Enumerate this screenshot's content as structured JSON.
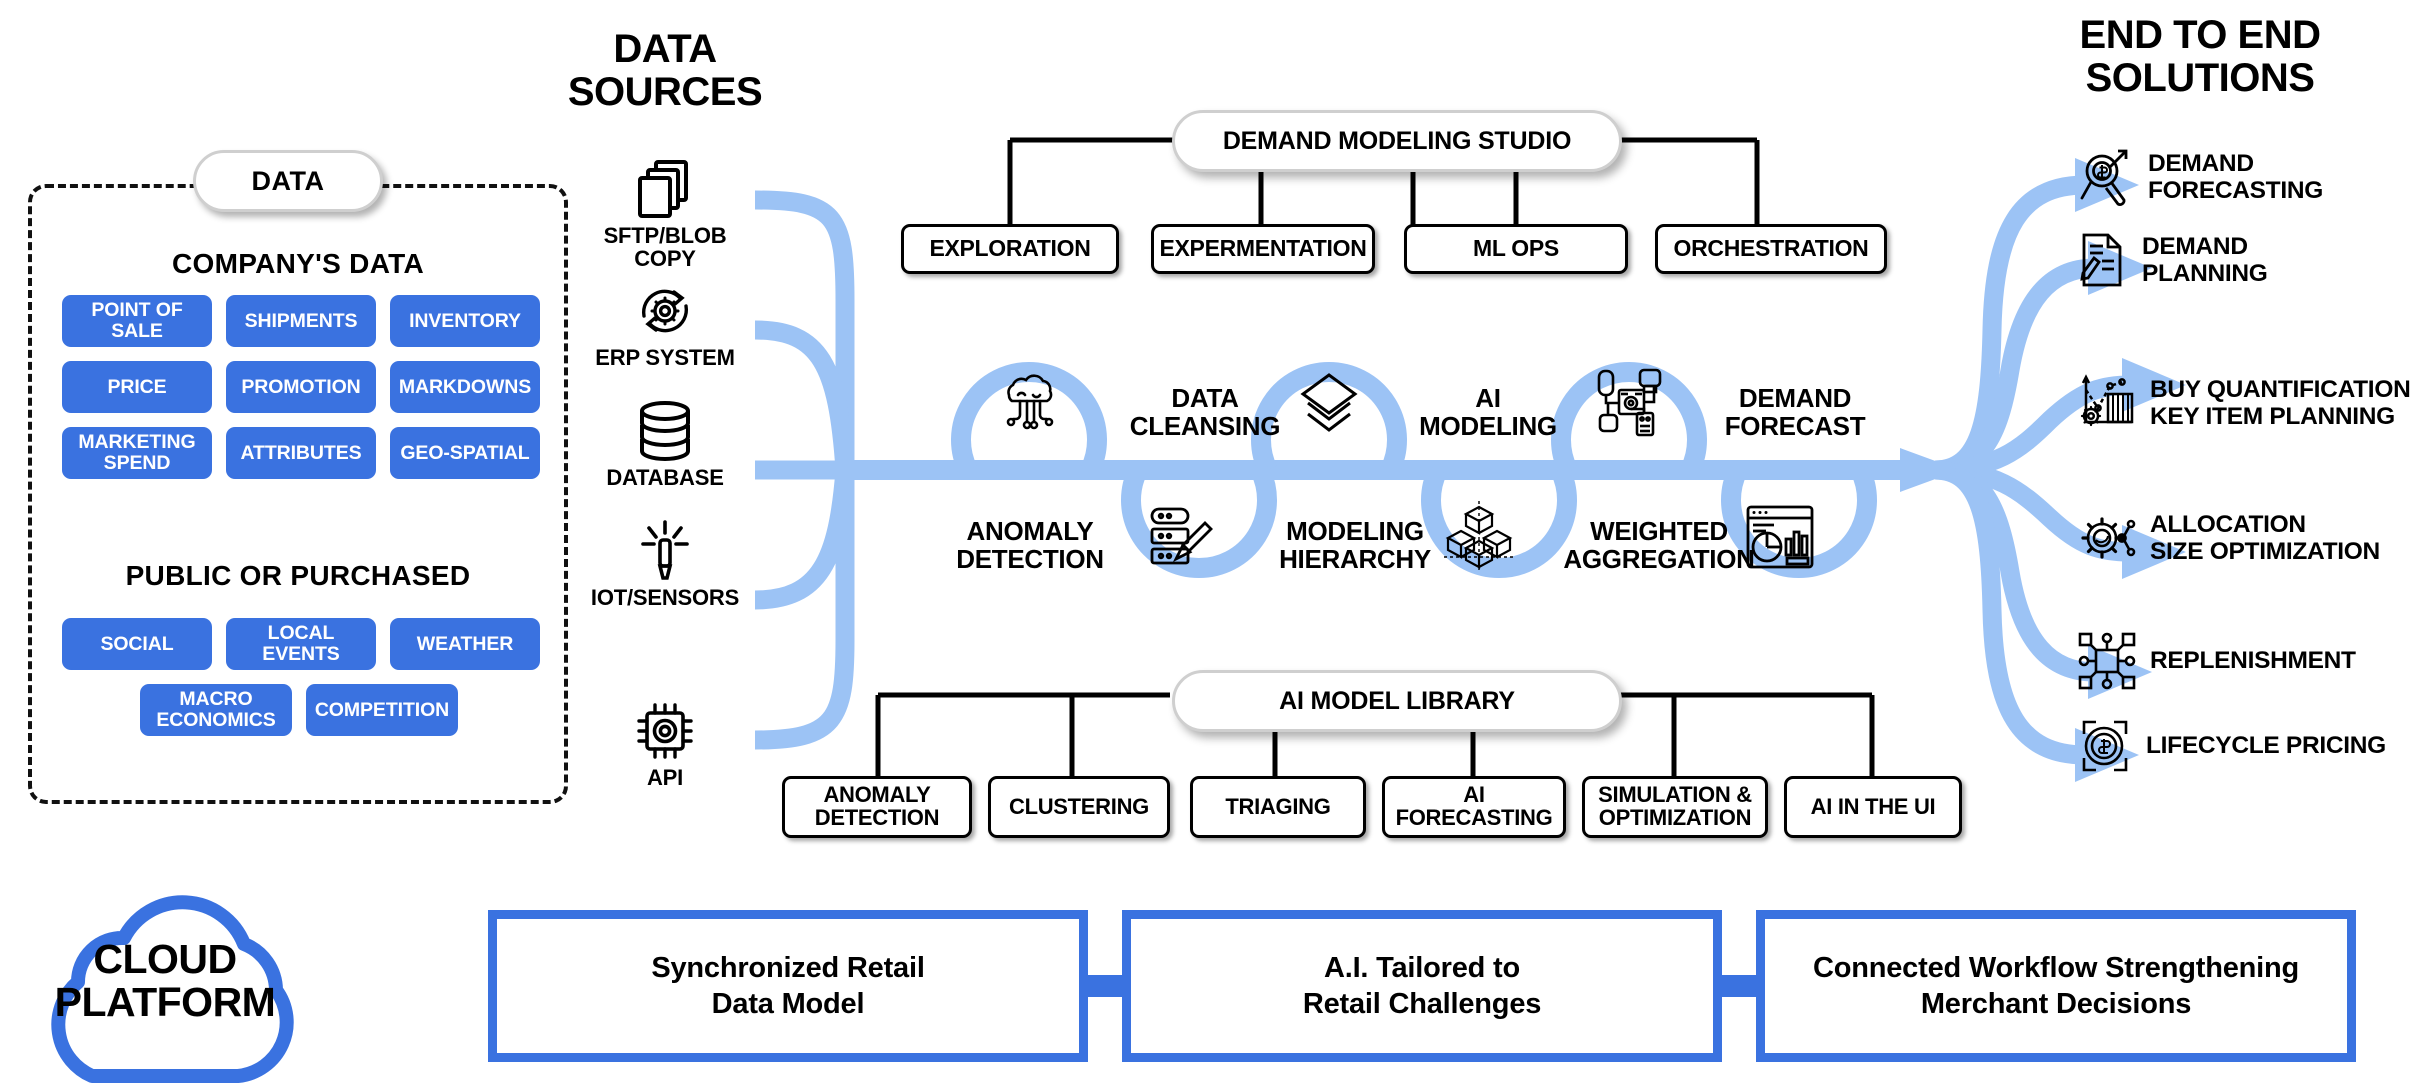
{
  "colors": {
    "brand_blue": "#3a72e0",
    "flow_blue": "#9cc3f5",
    "ink": "#000000"
  },
  "headings": {
    "data_sources": "DATA\nSOURCES",
    "end_to_end": "END TO END\nSOLUTIONS"
  },
  "data_panel": {
    "pill_label": "DATA",
    "company_title": "COMPANY'S DATA",
    "company_chips": [
      "POINT OF\nSALE",
      "SHIPMENTS",
      "INVENTORY",
      "PRICE",
      "PROMOTION",
      "MARKDOWNS",
      "MARKETING\nSPEND",
      "ATTRIBUTES",
      "GEO-SPATIAL"
    ],
    "public_title": "PUBLIC OR PURCHASED",
    "public_chips": [
      "SOCIAL",
      "LOCAL\nEVENTS",
      "WEATHER",
      "MACRO\nECONOMICS",
      "COMPETITION"
    ]
  },
  "data_sources": [
    {
      "icon": "documents-copy-icon",
      "label": "SFTP/BLOB\nCOPY"
    },
    {
      "icon": "erp-gear-cycle-icon",
      "label": "ERP SYSTEM"
    },
    {
      "icon": "database-icon",
      "label": "DATABASE"
    },
    {
      "icon": "iot-sensor-icon",
      "label": "IOT/SENSORS"
    },
    {
      "icon": "api-chip-icon",
      "label": "API"
    }
  ],
  "demand_modeling_studio": {
    "title": "DEMAND MODELING STUDIO",
    "children": [
      "EXPLORATION",
      "EXPERMENTATION",
      "ML OPS",
      "ORCHESTRATION"
    ]
  },
  "pipeline": {
    "top_stages": [
      {
        "icon": "ai-brain-icon",
        "label": "DATA\nCLEANSING"
      },
      {
        "icon": "layers-icon",
        "label": "AI\nMODELING"
      },
      {
        "icon": "ml-ops-network-icon",
        "label": "DEMAND\nFORECAST"
      }
    ],
    "bottom_stages": [
      {
        "icon": "server-brush-icon",
        "label": "ANOMALY\nDETECTION"
      },
      {
        "icon": "cubes-axis-icon",
        "label": "MODELING\nHIERARCHY"
      },
      {
        "icon": "dashboard-chart-icon",
        "label": "WEIGHTED\nAGGREGATION"
      }
    ]
  },
  "ai_model_library": {
    "title": "AI MODEL LIBRARY",
    "children": [
      "ANOMALY\nDETECTION",
      "CLUSTERING",
      "TRIAGING",
      "AI\nFORECASTING",
      "SIMULATION &\nOPTIMIZATION",
      "AI IN THE UI"
    ]
  },
  "solutions": [
    {
      "icon": "magnifier-dollar-growth-icon",
      "label": "DEMAND\nFORECASTING"
    },
    {
      "icon": "document-pencil-icon",
      "label": "DEMAND\nPLANNING"
    },
    {
      "icon": "chart-gear-icon",
      "label": "BUY QUANTIFICATION\nKEY ITEM PLANNING"
    },
    {
      "icon": "gear-node-icon",
      "label": "ALLOCATION\nSIZE OPTIMIZATION"
    },
    {
      "icon": "network-square-icon",
      "label": "REPLENISHMENT"
    },
    {
      "icon": "coin-dollar-cycle-icon",
      "label": "LIFECYCLE PRICING"
    }
  ],
  "footer": {
    "cloud_label": "CLOUD\nPLATFORM",
    "value_boxes": [
      "Synchronized Retail\nData Model",
      "A.I. Tailored to\nRetail Challenges",
      "Connected Workflow Strengthening\nMerchant Decisions"
    ]
  }
}
